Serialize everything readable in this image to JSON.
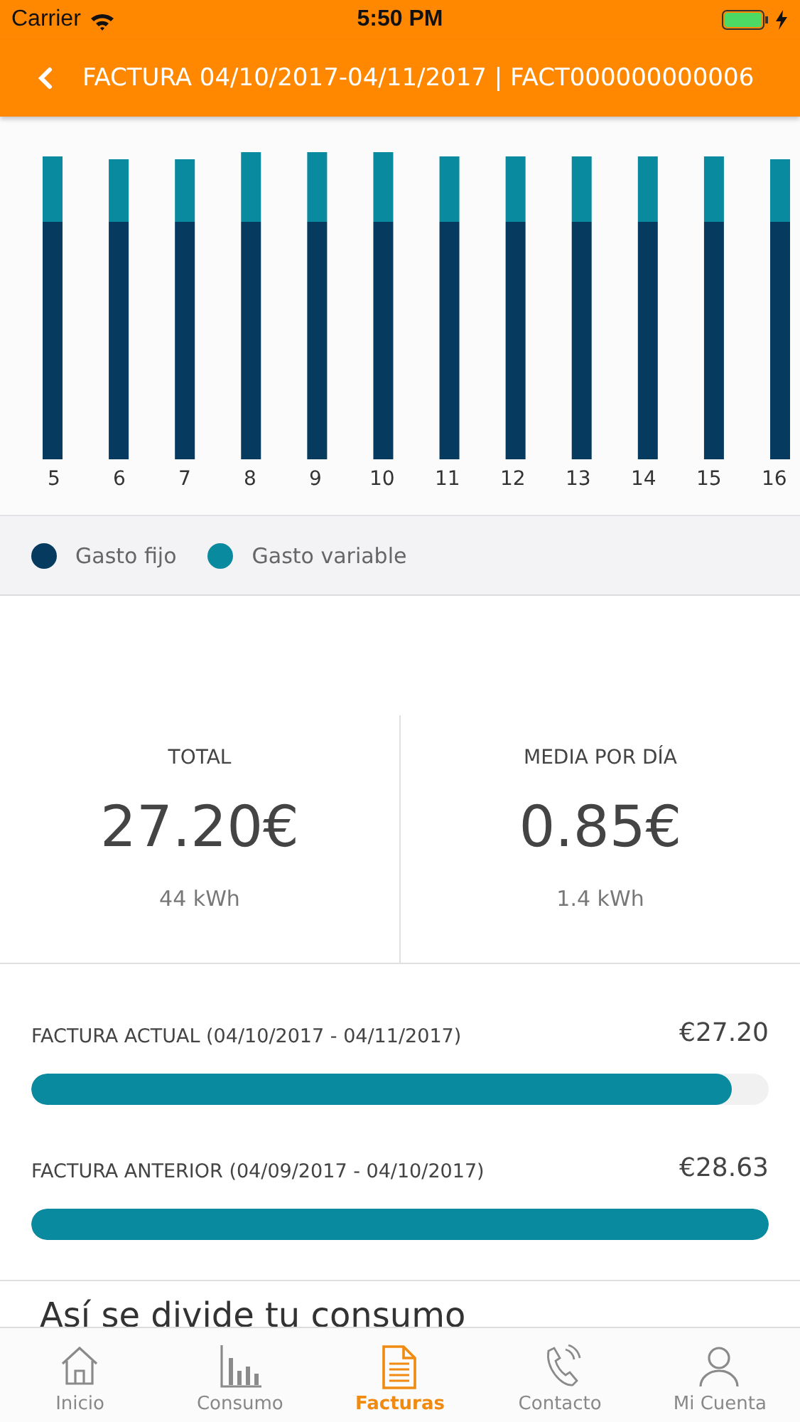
{
  "status_bar": {
    "carrier": "Carrier",
    "time": "5:50 PM"
  },
  "header": {
    "title": "FACTURA 04/10/2017-04/11/2017 | FACT000000000006"
  },
  "chart": {
    "day_labels": [
      "5",
      "6",
      "7",
      "8",
      "9",
      "10",
      "11",
      "12",
      "13",
      "14",
      "15",
      "16"
    ],
    "legend": [
      {
        "label": "Gasto fijo",
        "color": "#063a5e"
      },
      {
        "label": "Gasto variable",
        "color": "#0a8a9f"
      }
    ]
  },
  "summary": [
    {
      "label": "TOTAL",
      "amount": "27.20",
      "currency": "€",
      "energy": "44 kWh"
    },
    {
      "label": "MEDIA POR DÍA",
      "amount": "0.85",
      "currency": "€",
      "energy": "1.4 kWh"
    }
  ],
  "comparison": [
    {
      "label": "FACTURA ACTUAL (04/10/2017 - 04/11/2017)",
      "amount": "€27.20",
      "level": 0.95
    },
    {
      "label": "FACTURA ANTERIOR (04/09/2017 - 04/10/2017)",
      "amount": "€28.63",
      "level": 1.0
    }
  ],
  "section_heading": "Así se divide tu consumo",
  "tab_bar": [
    {
      "label": "Inicio",
      "kind": "home",
      "selected": false
    },
    {
      "label": "Consumo",
      "kind": "chart",
      "selected": false
    },
    {
      "label": "Facturas",
      "kind": "document",
      "selected": true
    },
    {
      "label": "Contacto",
      "kind": "phone",
      "selected": false
    },
    {
      "label": "Mi Cuenta",
      "kind": "user",
      "selected": false
    }
  ]
}
